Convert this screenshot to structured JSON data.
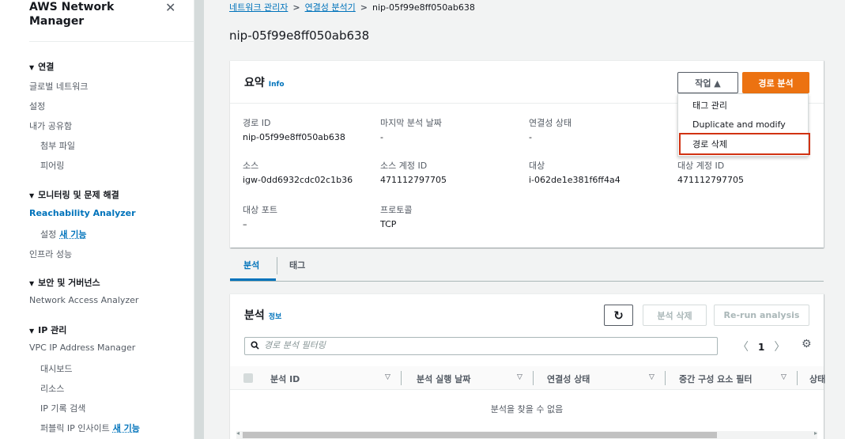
{
  "sidebar": {
    "title": "AWS Network Manager",
    "close_glyph": "✕",
    "items": [
      {
        "type": "section",
        "label": "연결",
        "glyph": "▼"
      },
      {
        "type": "item",
        "label": "글로벌 네트워크"
      },
      {
        "type": "item",
        "label": "설정"
      },
      {
        "type": "item",
        "label": "내가 공유함"
      },
      {
        "type": "sub",
        "label": "첨부 파일"
      },
      {
        "type": "sub",
        "label": "피어링"
      },
      {
        "type": "section",
        "label": "모니터링 및 문제 해결",
        "glyph": "▼"
      },
      {
        "type": "active",
        "label": "Reachability Analyzer"
      },
      {
        "type": "sub",
        "label": "설정",
        "badge": "새 기능"
      },
      {
        "type": "item",
        "label": "인프라 성능"
      },
      {
        "type": "section",
        "label": "보안 및 거버넌스",
        "glyph": "▼"
      },
      {
        "type": "item",
        "label": "Network Access Analyzer"
      },
      {
        "type": "section",
        "label": "IP 관리",
        "glyph": "▼"
      },
      {
        "type": "item",
        "label": "VPC IP Address Manager"
      },
      {
        "type": "sub",
        "label": "대시보드"
      },
      {
        "type": "sub",
        "label": "리소스"
      },
      {
        "type": "sub",
        "label": "IP 기록 검색"
      },
      {
        "type": "sub",
        "label": "퍼블릭 IP 인사이트",
        "badge": "새 기능"
      }
    ]
  },
  "breadcrumb": {
    "items": [
      "네트워크 관리자",
      "연결성 분석기"
    ],
    "current": "nip-05f99e8ff050ab638",
    "sep": ">"
  },
  "page_title": "nip-05f99e8ff050ab638",
  "summary": {
    "title": "요약",
    "info": "Info",
    "actions_label": "작업 ▲",
    "analyze_label": "경로 분석",
    "fields": [
      {
        "label": "경로 ID",
        "value": "nip-05f99e8ff050ab638"
      },
      {
        "label": "마지막 분석 날짜",
        "value": "-"
      },
      {
        "label": "연결성 상태",
        "value": "-"
      },
      {
        "label": "소스",
        "value": "igw-0dd6932cdc02c1b36"
      },
      {
        "label": "소스 계정 ID",
        "value": "471112797705"
      },
      {
        "label": "대상",
        "value": "i-062de1e381f6ff4a4"
      },
      {
        "label": "대상 계정 ID",
        "value": "471112797705"
      },
      {
        "label": "대상 포트",
        "value": "–"
      },
      {
        "label": "프로토콜",
        "value": "TCP"
      }
    ]
  },
  "actions_menu": {
    "items": [
      "태그 관리",
      "Duplicate and modify",
      "경로 삭제"
    ]
  },
  "tabs": [
    "분석",
    "태그"
  ],
  "analysis": {
    "title": "분석",
    "info": "정보",
    "refresh_glyph": "↻",
    "delete_label": "분석 삭제",
    "rerun_label": "Re-run analysis",
    "search_placeholder": "경로 분석 필터링",
    "page": "1",
    "columns": [
      "분석 ID",
      "분석 실행 날짜",
      "연결성 상태",
      "중간 구성 요소 필터",
      "상태"
    ],
    "empty": "분석을 찾을 수 없음"
  }
}
